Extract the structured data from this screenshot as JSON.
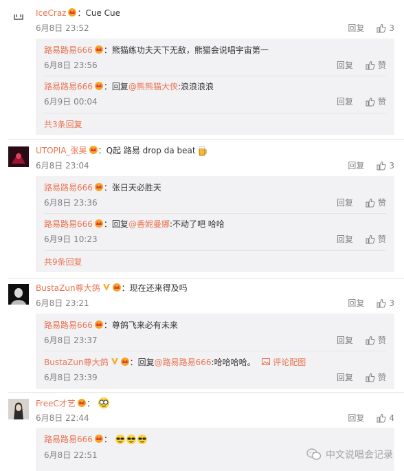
{
  "comments": [
    {
      "user": "IceCraz",
      "text": "Cue Cue",
      "time": "6月8日 23:52",
      "reply_label": "回复",
      "likes": "3",
      "replies": [
        {
          "user": "路易路易666",
          "text": "熊猫练功夫天下无敌，熊猫会说唱宇宙第一",
          "time": "6月8日 23:56",
          "reply_label": "回复",
          "like_label": "赞"
        },
        {
          "user": "路易路易666",
          "reply_prefix": "回复",
          "mention": "@熊熊猫大侠",
          "text": ":浪浪浪浪",
          "time": "6月9日 00:04",
          "reply_label": "回复",
          "like_label": "赞"
        }
      ],
      "more": "共3条回复"
    },
    {
      "user": "UTOPIA_张昊",
      "text": "Q起 路易  drop da beat",
      "time": "6月8日 23:04",
      "reply_label": "回复",
      "likes": "3",
      "replies": [
        {
          "user": "路易路易666",
          "text": "张日天必胜天",
          "time": "6月8日 23:36",
          "reply_label": "回复",
          "like_label": "赞"
        },
        {
          "user": "路易路易666",
          "reply_prefix": "回复",
          "mention": "@香妮曼娜",
          "text": ":不动了吧 哈哈",
          "time": "6月9日 10:23",
          "reply_label": "回复",
          "like_label": "赞"
        }
      ],
      "more": "共9条回复"
    },
    {
      "user": "BustaZun尊大鸽",
      "text": "现在还来得及吗",
      "time": "6月8日 23:21",
      "reply_label": "回复",
      "likes": "3",
      "replies": [
        {
          "user": "路易路易666",
          "text": "尊鸽飞来必有未来",
          "time": "6月8日 23:37",
          "reply_label": "回复",
          "like_label": "赞"
        },
        {
          "user": "BustaZun尊大鸽",
          "reply_prefix": "回复",
          "mention": "@路易路易666",
          "text": ":哈哈哈哈。",
          "extra": "评论配图",
          "time": "6月8日 23:39",
          "reply_label": "回复",
          "like_label": "赞"
        }
      ]
    },
    {
      "user": "FreeC才艺",
      "text": "",
      "time": "6月8日 22:44",
      "reply_label": "回复",
      "likes": "4",
      "replies": [
        {
          "user": "路易路易666",
          "text": "",
          "time": "6月8日 22:51"
        }
      ]
    }
  ],
  "watermark": "中文说唱会记录",
  "colors": {
    "name": "#eb7350",
    "meta": "#808080",
    "subbox": "#f2f2f5"
  }
}
